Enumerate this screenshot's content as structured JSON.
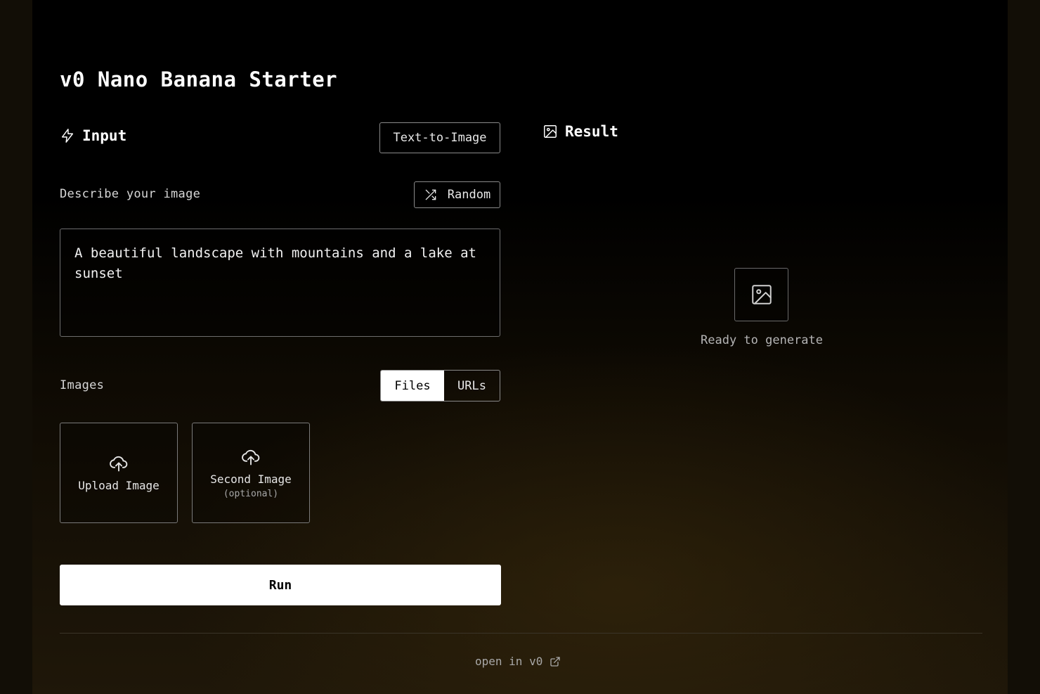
{
  "page": {
    "title": "v0 Nano Banana Starter"
  },
  "input": {
    "heading": "Input",
    "mode_label": "Text-to-Image",
    "describe_label": "Describe your image",
    "random_label": "Random",
    "prompt_value": "A beautiful landscape with mountains and a lake at sunset",
    "images_label": "Images",
    "tabs": [
      {
        "label": "Files",
        "active": true
      },
      {
        "label": "URLs",
        "active": false
      }
    ],
    "uploads": [
      {
        "label": "Upload Image",
        "sub": ""
      },
      {
        "label": "Second Image",
        "sub": "(optional)"
      }
    ],
    "run_label": "Run"
  },
  "result": {
    "heading": "Result",
    "status": "Ready to generate"
  },
  "footer": {
    "link_label": "open in v0"
  },
  "icons": {
    "input": "bolt-icon",
    "result": "image-icon",
    "random": "shuffle-icon",
    "upload": "cloud-upload-icon",
    "placeholder": "image-icon",
    "external": "external-link-icon"
  }
}
